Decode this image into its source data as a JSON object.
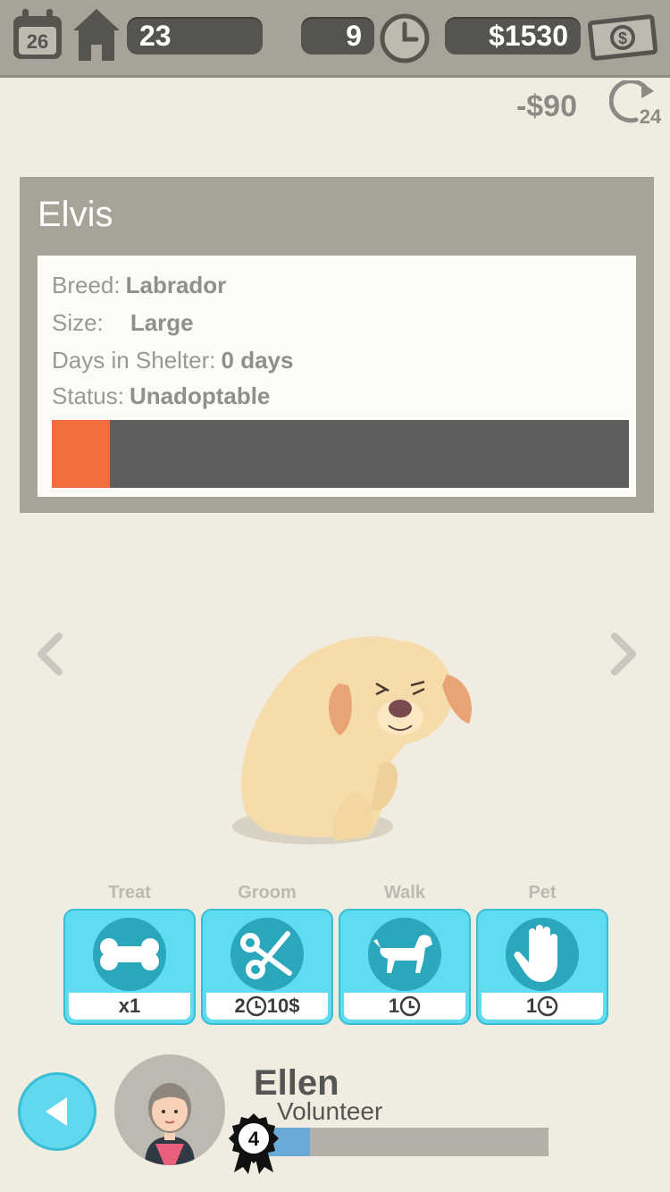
{
  "topbar": {
    "day": "26",
    "capacity": "23",
    "time_left": "9",
    "money": "$1530"
  },
  "daily_cost": {
    "amount": "-$90",
    "interval": "24"
  },
  "animal": {
    "name": "Elvis",
    "breed_label": "Breed:",
    "breed": "Labrador",
    "size_label": "Size:",
    "size": "Large",
    "days_label": "Days in Shelter:",
    "days": "0 days",
    "status_label": "Status:",
    "status": "Unadoptable",
    "adoptability_fraction": 0.1,
    "adoptability_color": "#f26d3d"
  },
  "actions": [
    {
      "label": "Treat",
      "cost": "x1",
      "icon": "bone-icon"
    },
    {
      "label": "Groom",
      "cost_time": "2",
      "cost_money": "10$",
      "icon": "scissors-icon"
    },
    {
      "label": "Walk",
      "cost_time": "1",
      "icon": "walking-dog-icon"
    },
    {
      "label": "Pet",
      "cost_time": "1",
      "icon": "hand-icon"
    }
  ],
  "worker": {
    "name": "Ellen",
    "role": "Volunteer",
    "level": "4",
    "xp_fraction": 0.15
  },
  "colors": {
    "accent": "#5fdcef",
    "action_circle": "#2aa7bb",
    "bar_bg": "#5f5f5f"
  }
}
